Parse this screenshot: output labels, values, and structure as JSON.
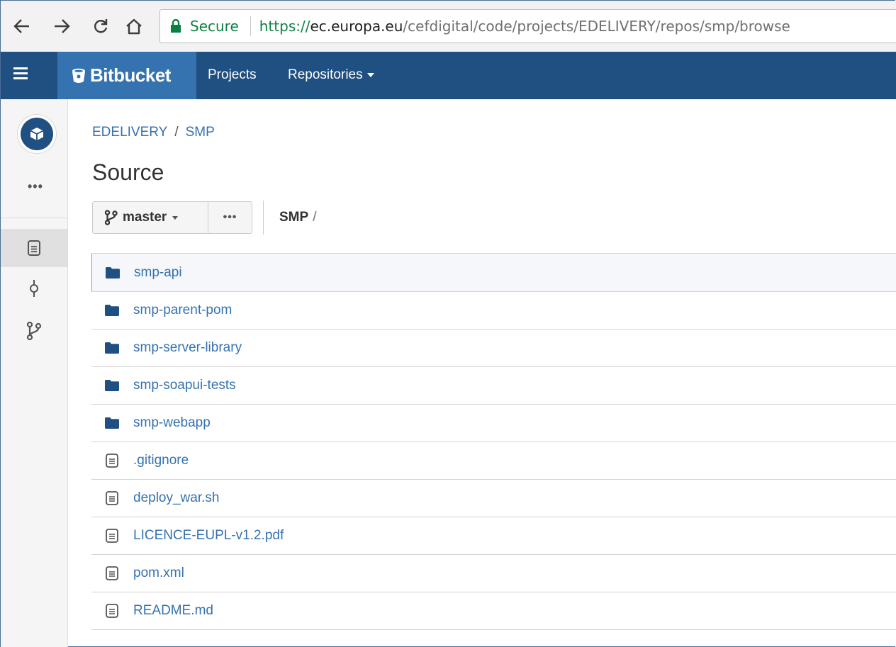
{
  "browser": {
    "secure_label": "Secure",
    "url_scheme": "https://",
    "url_host": "ec.europa.eu",
    "url_path": "/cefdigital/code/projects/EDELIVERY/repos/smp/browse"
  },
  "header": {
    "logo_text": "Bitbucket",
    "nav": {
      "projects": "Projects",
      "repositories": "Repositories"
    }
  },
  "sidebar": {
    "more": "•••"
  },
  "breadcrumb": {
    "project": "EDELIVERY",
    "separator": "/",
    "repo": "SMP"
  },
  "page_title": "Source",
  "toolbar": {
    "branch": "master",
    "more": "•••"
  },
  "path": {
    "root": "SMP",
    "separator": "/"
  },
  "files": [
    {
      "name": "smp-api",
      "type": "folder"
    },
    {
      "name": "smp-parent-pom",
      "type": "folder"
    },
    {
      "name": "smp-server-library",
      "type": "folder"
    },
    {
      "name": "smp-soapui-tests",
      "type": "folder"
    },
    {
      "name": "smp-webapp",
      "type": "folder"
    },
    {
      "name": ".gitignore",
      "type": "file"
    },
    {
      "name": "deploy_war.sh",
      "type": "file"
    },
    {
      "name": "LICENCE-EUPL-v1.2.pdf",
      "type": "file"
    },
    {
      "name": "pom.xml",
      "type": "file"
    },
    {
      "name": "README.md",
      "type": "file"
    }
  ],
  "colors": {
    "header": "#205081",
    "logo_bg": "#3572b0",
    "link": "#3572b0",
    "secure": "#0b8043"
  }
}
